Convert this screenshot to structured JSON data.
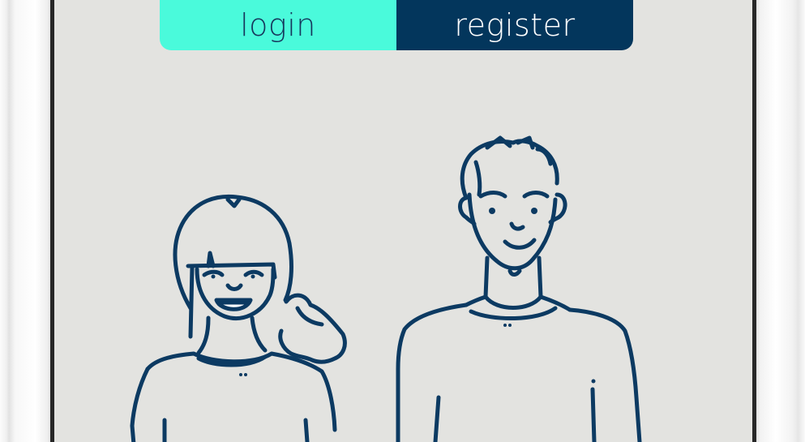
{
  "auth_tabs": {
    "login_label": "login",
    "register_label": "register"
  },
  "colors": {
    "login_tab": "#4afadb",
    "register_tab": "#03365c",
    "screen_background": "#e3e3e0",
    "line_art": "#0c3a62"
  },
  "illustration": {
    "icon": "couple-illustration",
    "figures": [
      "woman-figure",
      "man-figure"
    ]
  }
}
